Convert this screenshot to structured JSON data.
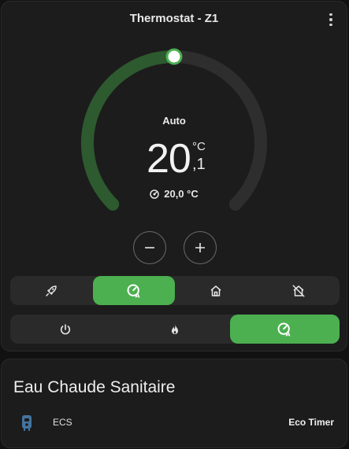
{
  "thermostat": {
    "title": "Thermostat - Z1",
    "mode_label": "Auto",
    "target_integer": "20",
    "target_decimal": ",1",
    "target_unit": "°C",
    "current_temp": "20,0 °C",
    "setpoint_fraction": 0.5,
    "presets": [
      {
        "name": "boost",
        "icon": "rocket-icon",
        "active": false
      },
      {
        "name": "auto",
        "icon": "thermostat-auto-icon",
        "active": true
      },
      {
        "name": "home",
        "icon": "home-icon",
        "active": false
      },
      {
        "name": "away",
        "icon": "home-off-icon",
        "active": false
      }
    ],
    "hvac_modes": [
      {
        "name": "off",
        "icon": "power-icon",
        "active": false
      },
      {
        "name": "heat",
        "icon": "flame-icon",
        "active": false
      },
      {
        "name": "auto",
        "icon": "thermostat-auto-icon",
        "active": true
      }
    ],
    "colors": {
      "accent": "#4caf50",
      "track": "#2e2e2e",
      "arc": "#2d5a2f"
    }
  },
  "ecs": {
    "title": "Eau Chaude Sanitaire",
    "entity_name": "ECS",
    "entity_icon": "water-boiler-icon",
    "entity_state": "Eco Timer"
  }
}
